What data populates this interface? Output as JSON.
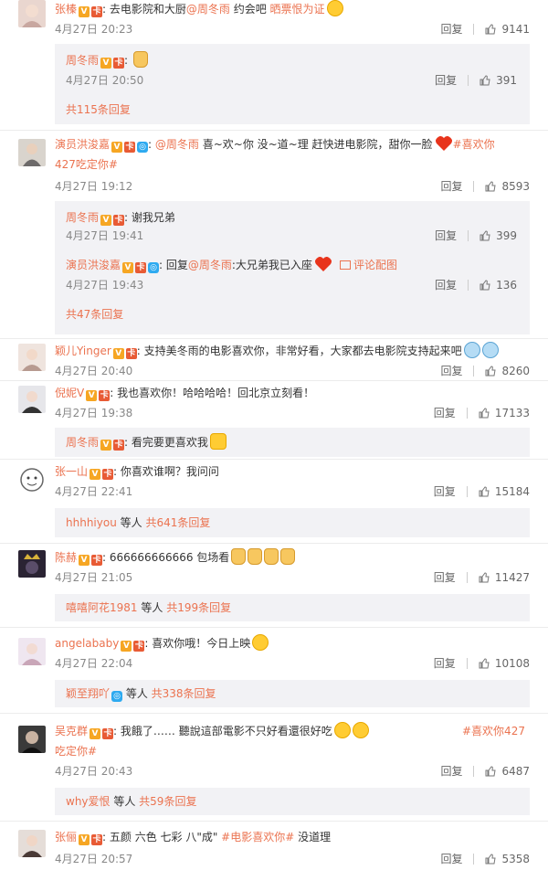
{
  "labels": {
    "reply": "回复"
  },
  "comments": [
    {
      "user": "张榛",
      "badges": [
        "V",
        "卡"
      ],
      "segments": [
        ": 去电影院和大厨",
        "@周冬雨",
        " 约会吧 ",
        "晒票恨为证"
      ],
      "time": "4月27日 20:23",
      "likes": "9141",
      "replies": [
        {
          "user": "周冬雨",
          "badges": [
            "V",
            "卡"
          ],
          "text": ": ",
          "time": "4月27日 20:50",
          "likes": "391"
        }
      ],
      "more": "共115条回复"
    },
    {
      "user": "演员洪浚嘉",
      "badges": [
        "V",
        "卡",
        "◎"
      ],
      "segments": [
        ": ",
        "@周冬雨",
        " 喜~欢~你 没~道~理 赶快进电影院，甜你一脸",
        "#喜欢你",
        "427吃定你#"
      ],
      "time": "4月27日 19:12",
      "likes": "8593",
      "replies": [
        {
          "user": "周冬雨",
          "badges": [
            "V",
            "卡"
          ],
          "text": ": 谢我兄弟",
          "time": "4月27日 19:41",
          "likes": "399"
        },
        {
          "user": "演员洪浚嘉",
          "badges": [
            "V",
            "卡",
            "◎"
          ],
          "text": ": 回复",
          "mention": "@周冬雨",
          "text2": ":大兄弟我已入座",
          "pin": "评论配图",
          "time": "4月27日 19:43",
          "likes": "136"
        }
      ],
      "more": "共47条回复"
    },
    {
      "user": "颖儿Yinger",
      "badges": [
        "V",
        "卡"
      ],
      "segments": [
        ": 支持美冬雨的电影喜欢你，非常好看，大家都去电影院支持起来吧"
      ],
      "time": "4月27日 20:40",
      "likes": "8260"
    },
    {
      "user": "倪妮V",
      "badges": [
        "V",
        "卡"
      ],
      "segments": [
        ": 我也喜欢你！哈哈哈哈！回北京立刻看！"
      ],
      "time": "4月27日 19:38",
      "likes": "17133",
      "replies": [
        {
          "user": "周冬雨",
          "badges": [
            "V",
            "卡"
          ],
          "text": ": 看完要更喜欢我",
          "time": "",
          "likes": ""
        }
      ]
    },
    {
      "user": "张一山",
      "badges": [
        "V",
        "卡"
      ],
      "segments": [
        ": 你喜欢谁啊？我问问"
      ],
      "time": "4月27日 22:41",
      "likes": "15184",
      "more_who": "hhhhiyou",
      "more_mid": " 等人 ",
      "more": "共641条回复"
    },
    {
      "user": "陈赫",
      "badges": [
        "V",
        "卡"
      ],
      "segments": [
        ": 666666666666 包场看"
      ],
      "time": "4月27日 21:05",
      "likes": "11427",
      "more_who": "嘻嘻阿花1981",
      "more_mid": " 等人 ",
      "more": "共199条回复"
    },
    {
      "user": "angelababy",
      "badges": [
        "V",
        "卡"
      ],
      "segments": [
        ": 喜欢你哦！今日上映"
      ],
      "time": "4月27日 22:04",
      "likes": "10108",
      "more_who": "颖至翔吖",
      "more_mid": " 等人 ",
      "more": "共338条回复"
    },
    {
      "user": "吴克群",
      "badges": [
        "V",
        "卡"
      ],
      "segments": [
        ": 我餓了……            聽說這部電影不只好看還很好吃",
        "#喜欢你427",
        "吃定你#"
      ],
      "time": "4月27日 20:43",
      "likes": "6487",
      "more_who": "why爱恨",
      "more_mid": " 等人 ",
      "more": "共59条回复"
    },
    {
      "user": "张俪",
      "badges": [
        "V",
        "卡"
      ],
      "segments": [
        ": 五颜 六色 七彩 八\"成\" ",
        "#电影喜欢你#",
        " 没道理"
      ],
      "time": "4月27日 20:57",
      "likes": "5358"
    }
  ],
  "colors": {
    "accent": "#eb7350",
    "reply_bg": "#f2f2f5",
    "time": "#888888"
  }
}
